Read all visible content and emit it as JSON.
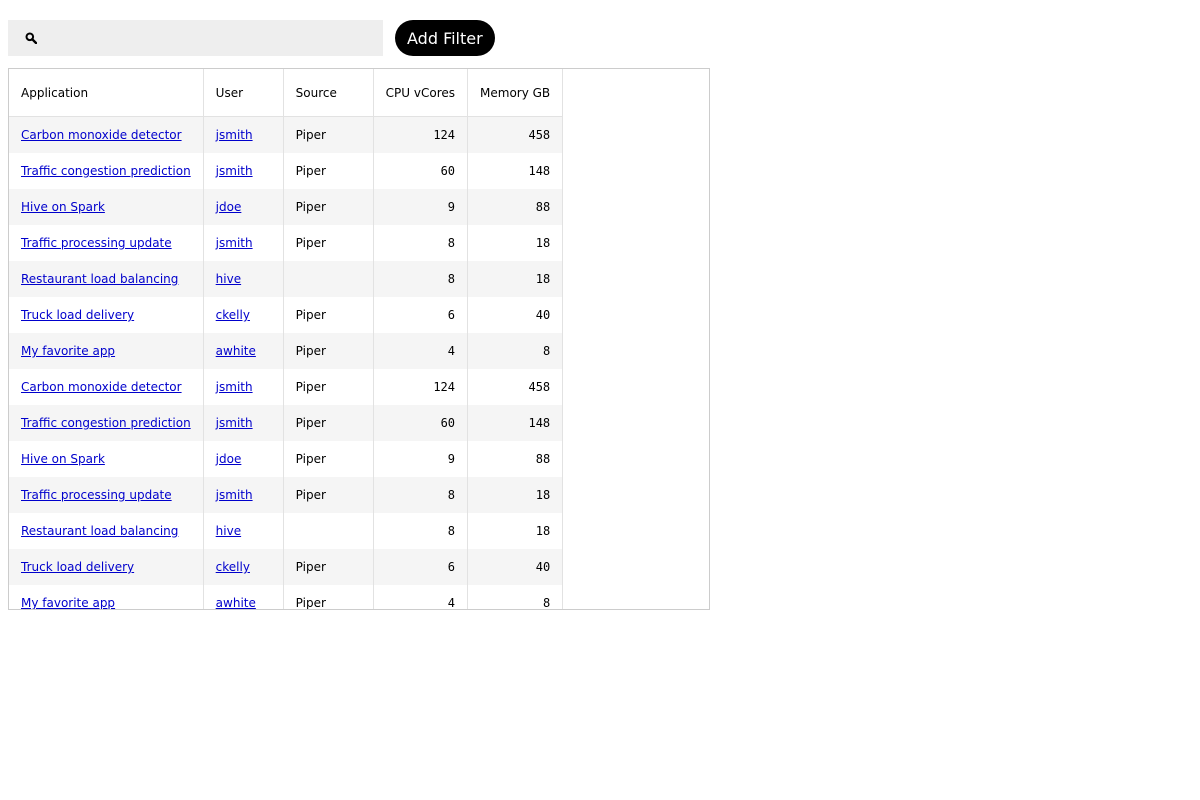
{
  "toolbar": {
    "search_icon": "search-icon",
    "search_value": "",
    "search_placeholder": "",
    "add_filter_label": "Add Filter"
  },
  "table": {
    "columns": [
      "Application",
      "User",
      "Source",
      "CPU vCores",
      "Memory GB"
    ],
    "rows": [
      {
        "application": "Carbon monoxide detector",
        "user": "jsmith",
        "source": "Piper",
        "cpu": "124",
        "memory": "458"
      },
      {
        "application": "Traffic congestion prediction",
        "user": "jsmith",
        "source": "Piper",
        "cpu": "60",
        "memory": "148"
      },
      {
        "application": "Hive on Spark",
        "user": "jdoe",
        "source": "Piper",
        "cpu": "9",
        "memory": "88"
      },
      {
        "application": "Traffic processing update",
        "user": "jsmith",
        "source": "Piper",
        "cpu": "8",
        "memory": "18"
      },
      {
        "application": "Restaurant load balancing",
        "user": "hive",
        "source": "",
        "cpu": "8",
        "memory": "18"
      },
      {
        "application": "Truck load delivery",
        "user": "ckelly",
        "source": "Piper",
        "cpu": "6",
        "memory": "40"
      },
      {
        "application": "My favorite app",
        "user": "awhite",
        "source": "Piper",
        "cpu": "4",
        "memory": "8"
      },
      {
        "application": "Carbon monoxide detector",
        "user": "jsmith",
        "source": "Piper",
        "cpu": "124",
        "memory": "458"
      },
      {
        "application": "Traffic congestion prediction",
        "user": "jsmith",
        "source": "Piper",
        "cpu": "60",
        "memory": "148"
      },
      {
        "application": "Hive on Spark",
        "user": "jdoe",
        "source": "Piper",
        "cpu": "9",
        "memory": "88"
      },
      {
        "application": "Traffic processing update",
        "user": "jsmith",
        "source": "Piper",
        "cpu": "8",
        "memory": "18"
      },
      {
        "application": "Restaurant load balancing",
        "user": "hive",
        "source": "",
        "cpu": "8",
        "memory": "18"
      },
      {
        "application": "Truck load delivery",
        "user": "ckelly",
        "source": "Piper",
        "cpu": "6",
        "memory": "40"
      },
      {
        "application": "My favorite app",
        "user": "awhite",
        "source": "Piper",
        "cpu": "4",
        "memory": "8"
      }
    ]
  }
}
